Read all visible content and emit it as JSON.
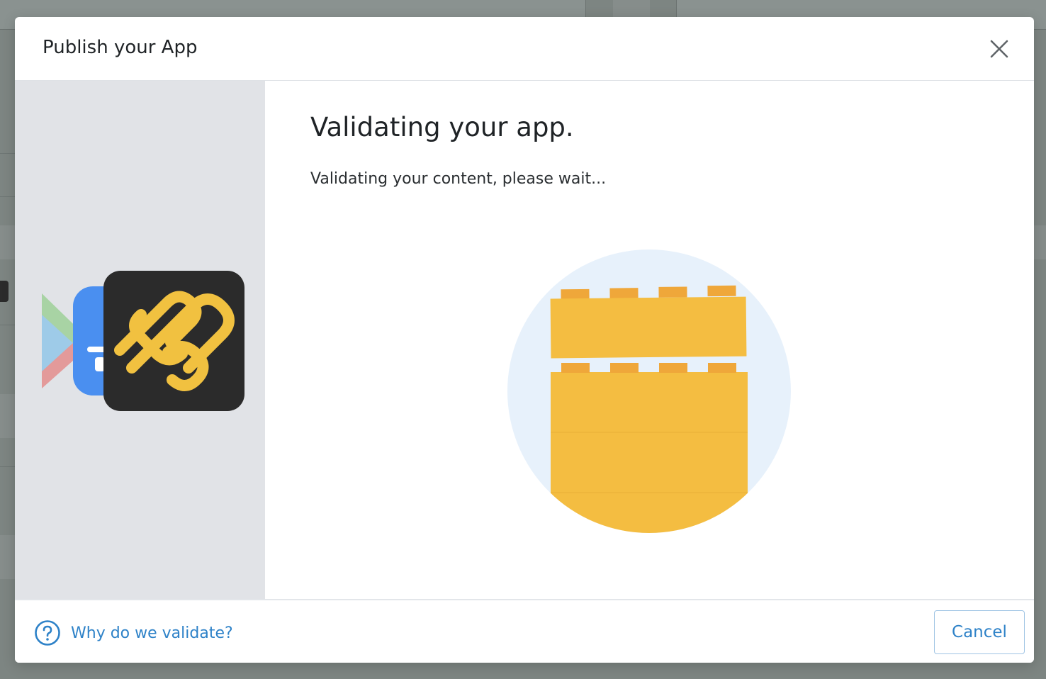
{
  "modal": {
    "title": "Publish your App",
    "heading": "Validating your app.",
    "subtext": "Validating your content, please wait...",
    "help_link": "Why do we validate?",
    "cancel_label": "Cancel"
  },
  "icons": {
    "close": "close-icon",
    "help": "question-circle-icon",
    "google_play": "google-play-icon",
    "testflight": "testflight-icon",
    "app": "app-logo-icon",
    "building_blocks": "building-blocks-illustration"
  },
  "colors": {
    "accent": "#2e82c8",
    "block": "#f4bd41",
    "block_stud": "#efa73a",
    "circle": "#e7f1fb",
    "app_icon_bg": "#2b2b2b",
    "app_icon_fg": "#f1c140"
  }
}
